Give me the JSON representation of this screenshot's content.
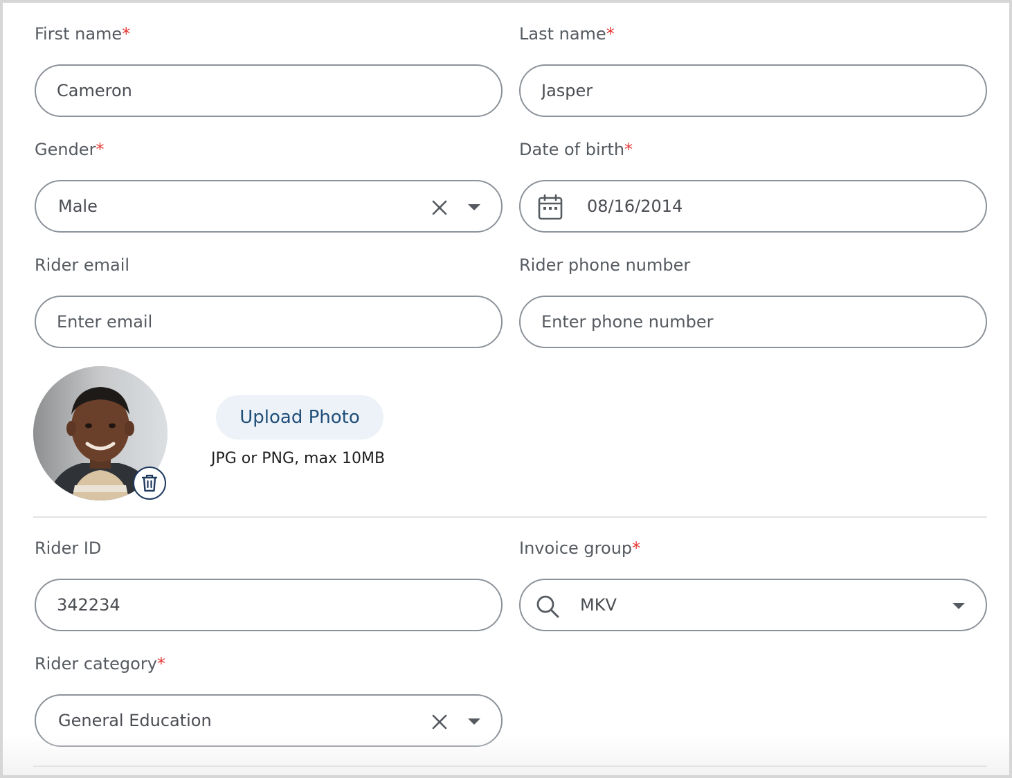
{
  "first_name": {
    "label": "First name",
    "required": "*",
    "value": "Cameron"
  },
  "last_name": {
    "label": "Last name",
    "required": "*",
    "value": "Jasper"
  },
  "gender": {
    "label": "Gender",
    "required": "*",
    "value": "Male"
  },
  "date_of_birth": {
    "label": "Date of birth",
    "required": "*",
    "value": "08/16/2014"
  },
  "rider_email": {
    "label": "Rider email",
    "placeholder": "Enter email"
  },
  "rider_phone": {
    "label": "Rider phone number",
    "placeholder": "Enter phone number"
  },
  "photo": {
    "upload_label": "Upload Photo",
    "hint": "JPG or PNG, max 10MB"
  },
  "rider_id": {
    "label": "Rider ID",
    "value": "342234"
  },
  "invoice_group": {
    "label": "Invoice group",
    "required": "*",
    "value": "MKV"
  },
  "rider_category": {
    "label": "Rider category",
    "required": "*",
    "value": "General Education"
  },
  "colors": {
    "required": "#e53935",
    "field_border": "#8c9299",
    "upload_text": "#1f4e79",
    "upload_bg": "#edf2f8"
  },
  "icons": [
    "clear-icon",
    "dropdown-arrow-icon",
    "calendar-icon",
    "search-icon",
    "trash-icon"
  ]
}
